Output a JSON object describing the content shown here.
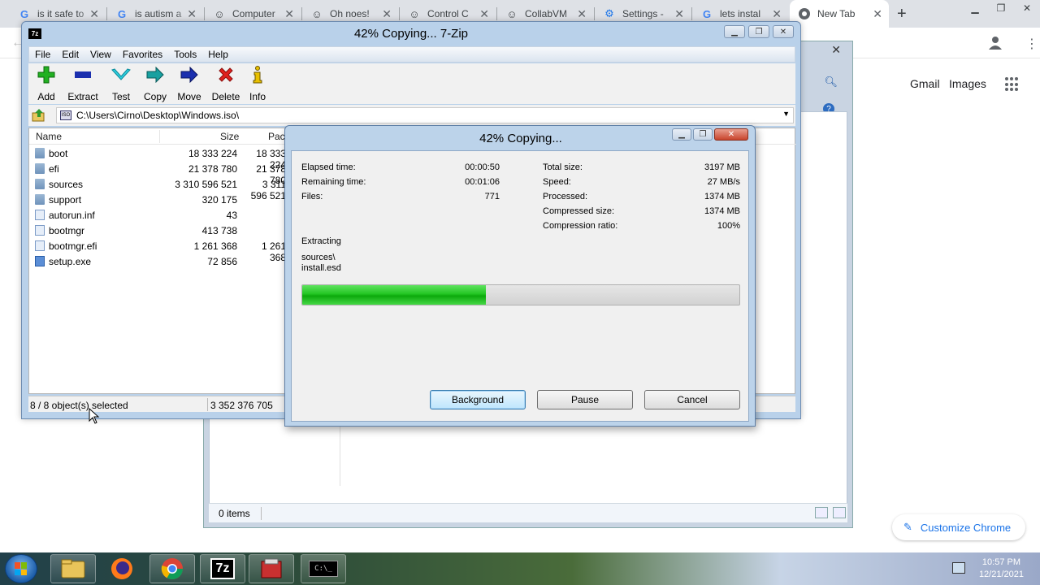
{
  "chrome": {
    "tabs": [
      {
        "title": "is it safe to",
        "icon": "google-icon"
      },
      {
        "title": "is autism a",
        "icon": "google-icon"
      },
      {
        "title": "Computer",
        "icon": "collabvm-icon"
      },
      {
        "title": "Oh noes!",
        "icon": "collabvm-icon"
      },
      {
        "title": "Control C",
        "icon": "collabvm-icon"
      },
      {
        "title": "CollabVM",
        "icon": "collabvm-icon"
      },
      {
        "title": "Settings -",
        "icon": "gear-icon"
      },
      {
        "title": "lets instal",
        "icon": "google-icon"
      },
      {
        "title": "New Tab",
        "icon": "chrome-icon"
      }
    ],
    "gmail": "Gmail",
    "images": "Images",
    "customize": "Customize Chrome"
  },
  "explorer": {
    "status_items": "0 items"
  },
  "szip": {
    "title": "42% Copying... 7-Zip",
    "app_icon": "7z",
    "menu": [
      "File",
      "Edit",
      "View",
      "Favorites",
      "Tools",
      "Help"
    ],
    "toolbar": [
      {
        "label": "Add",
        "icon": "add-icon",
        "color": "#1fa51f"
      },
      {
        "label": "Extract",
        "icon": "extract-icon",
        "color": "#1b2fae"
      },
      {
        "label": "Test",
        "icon": "test-icon",
        "color": "#0ab3c7"
      },
      {
        "label": "Copy",
        "icon": "copy-icon",
        "color": "#0f8f8f"
      },
      {
        "label": "Move",
        "icon": "move-icon",
        "color": "#1b2fae"
      },
      {
        "label": "Delete",
        "icon": "delete-icon",
        "color": "#d01c1c"
      },
      {
        "label": "Info",
        "icon": "info-icon",
        "color": "#8a6d00"
      }
    ],
    "path": "C:\\Users\\Cirno\\Desktop\\Windows.iso\\",
    "columns": {
      "name": "Name",
      "size": "Size",
      "packed": "Packed Size"
    },
    "files": [
      {
        "name": "boot",
        "size": "18 333 224",
        "packed": "18 333 224",
        "type": "folder"
      },
      {
        "name": "efi",
        "size": "21 378 780",
        "packed": "21 378 780",
        "type": "folder"
      },
      {
        "name": "sources",
        "size": "3 310 596 521",
        "packed": "3 311 596 521",
        "type": "folder"
      },
      {
        "name": "support",
        "size": "320 175",
        "packed": "",
        "type": "folder"
      },
      {
        "name": "autorun.inf",
        "size": "43",
        "packed": "",
        "type": "file"
      },
      {
        "name": "bootmgr",
        "size": "413 738",
        "packed": "",
        "type": "file"
      },
      {
        "name": "bootmgr.efi",
        "size": "1 261 368",
        "packed": "1 261 368",
        "type": "file"
      },
      {
        "name": "setup.exe",
        "size": "72 856",
        "packed": "",
        "type": "exe"
      }
    ],
    "status_selected": "8 / 8 object(s) selected",
    "status_total": "3 352 376 705"
  },
  "dialog": {
    "title": "42% Copying...",
    "elapsed_label": "Elapsed time:",
    "elapsed": "00:00:50",
    "remaining_label": "Remaining time:",
    "remaining": "00:01:06",
    "files_label": "Files:",
    "files": "771",
    "total_label": "Total size:",
    "total": "3197 MB",
    "speed_label": "Speed:",
    "speed": "27 MB/s",
    "processed_label": "Processed:",
    "processed": "1374 MB",
    "compressed_label": "Compressed size:",
    "compressed": "1374 MB",
    "ratio_label": "Compression ratio:",
    "ratio": "100%",
    "operation": "Extracting",
    "current_dir": "sources\\",
    "current_file": "install.esd",
    "progress_percent": 42,
    "buttons": {
      "background": "Background",
      "pause": "Pause",
      "cancel": "Cancel"
    }
  },
  "taskbar": {
    "time": "10:57 PM",
    "date": "12/21/2021",
    "sevenzip_label": "7z",
    "cmd_label": "C:\\_"
  }
}
